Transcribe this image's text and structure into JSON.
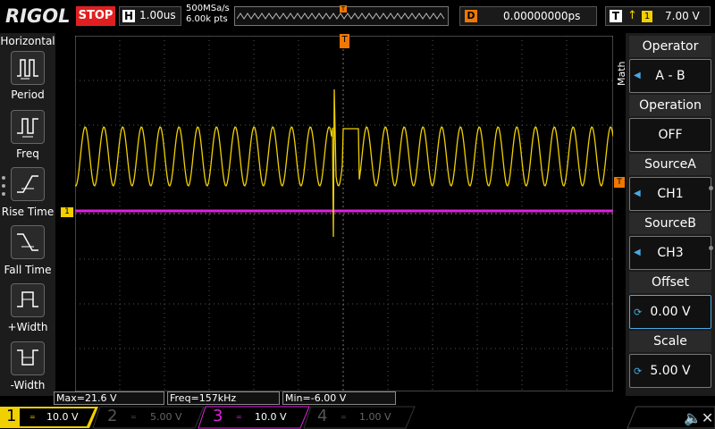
{
  "topbar": {
    "brand": "RIGOL",
    "run_state": "STOP",
    "horizontal_label": "H",
    "timebase": "1.00us",
    "sample_rate": "500MSa/s",
    "memory_depth": "6.00k pts",
    "trigger_pos_marker": "T",
    "delay_label": "D",
    "delay_value": "0.00000000ps",
    "trigger_label": "T",
    "trigger_edge": "↑",
    "trigger_source": "1",
    "trigger_level": "7.00 V"
  },
  "left_panel": {
    "title": "Horizontal",
    "items": [
      {
        "label": "Period",
        "icon": "period-icon"
      },
      {
        "label": "Freq",
        "icon": "frequency-icon"
      },
      {
        "label": "Rise Time",
        "icon": "rise-time-icon"
      },
      {
        "label": "Fall Time",
        "icon": "fall-time-icon"
      },
      {
        "label": "+Width",
        "icon": "positive-width-icon"
      },
      {
        "label": "-Width",
        "icon": "negative-width-icon"
      }
    ]
  },
  "right_panel": {
    "menu_title": "Math",
    "items": [
      {
        "label": "Operator",
        "value": "A - B",
        "control": "arrow"
      },
      {
        "label": "Operation",
        "value": "OFF",
        "control": "none"
      },
      {
        "label": "SourceA",
        "value": "CH1",
        "control": "arrow"
      },
      {
        "label": "SourceB",
        "value": "CH3",
        "control": "arrow"
      },
      {
        "label": "Offset",
        "value": "0.00 V",
        "control": "knob"
      },
      {
        "label": "Scale",
        "value": "5.00 V",
        "control": "knob"
      }
    ]
  },
  "markers": {
    "ch1": "1",
    "trigger_position": "T",
    "trigger_level": "T"
  },
  "measurements": {
    "max": "Max=21.6 V",
    "freq": "Freq=157kHz",
    "min": "Min=-6.00 V"
  },
  "channels": [
    {
      "num": "1",
      "coupling": "=",
      "scale": "10.0 V",
      "color": "#f0d000",
      "active": true
    },
    {
      "num": "2",
      "coupling": "=",
      "scale": "5.00 V",
      "color": "#1ec8c8",
      "active": false
    },
    {
      "num": "3",
      "coupling": "=",
      "scale": "10.0 V",
      "color": "#e020e0",
      "active": true
    },
    {
      "num": "4",
      "coupling": "=",
      "scale": "1.00 V",
      "color": "#2090ff",
      "active": false
    }
  ],
  "colors": {
    "ch1": "#f0d000",
    "ch3": "#e020e0",
    "trigger": "#f07800",
    "stop": "#e02020",
    "selection": "#4aa8e0"
  }
}
